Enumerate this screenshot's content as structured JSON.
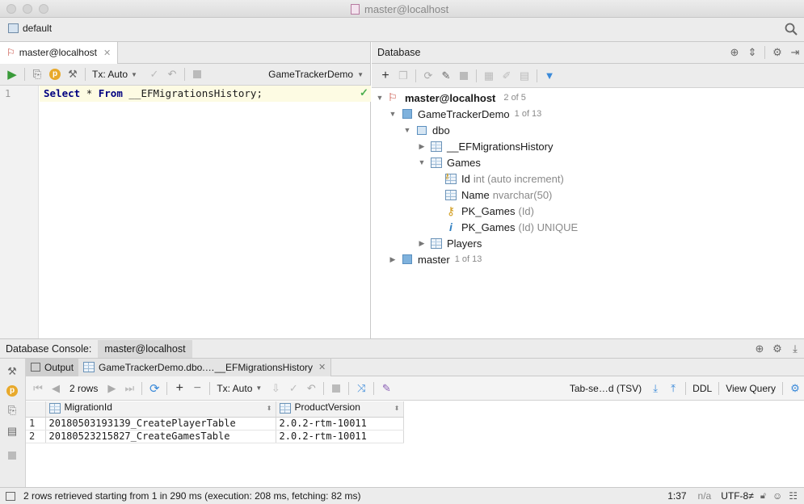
{
  "window": {
    "title": "master@localhost"
  },
  "navbar": {
    "breadcrumb": "default"
  },
  "editor": {
    "tab_label": "master@localhost",
    "tx_mode": "Tx: Auto",
    "schema": "GameTrackerDemo",
    "line_number": "1",
    "code": {
      "kw1": "Select",
      "star": "*",
      "kw2": "From",
      "ident": "__EFMigrationsHistory",
      "semi": ";"
    }
  },
  "database": {
    "title": "Database",
    "tree": [
      {
        "label": "master@localhost",
        "meta": "2 of 5"
      },
      {
        "label": "GameTrackerDemo",
        "meta": "1 of 13"
      },
      {
        "label": "dbo",
        "meta": ""
      },
      {
        "label": "__EFMigrationsHistory",
        "meta": ""
      },
      {
        "label": "Games",
        "meta": ""
      },
      {
        "label": "Id",
        "meta": "int (auto increment)"
      },
      {
        "label": "Name",
        "meta": "nvarchar(50)"
      },
      {
        "label": "PK_Games",
        "meta": "(Id)"
      },
      {
        "label": "PK_Games",
        "meta": "(Id) UNIQUE"
      },
      {
        "label": "Players",
        "meta": ""
      },
      {
        "label": "master",
        "meta": "1 of 13"
      }
    ]
  },
  "console": {
    "title": "Database Console:",
    "tab": "master@localhost",
    "output_tab": "Output",
    "result_tab": "GameTrackerDemo.dbo.…__EFMigrationsHistory",
    "rows_label": "2 rows",
    "tx_mode": "Tx: Auto",
    "format": "Tab-se…d (TSV)",
    "ddl": "DDL",
    "view_query": "View Query",
    "columns": [
      "MigrationId",
      "ProductVersion"
    ],
    "rows": [
      {
        "n": "1",
        "cells": [
          "20180503193139_CreatePlayerTable",
          "2.0.2-rtm-10011"
        ]
      },
      {
        "n": "2",
        "cells": [
          "20180523215827_CreateGamesTable",
          "2.0.2-rtm-10011"
        ]
      }
    ]
  },
  "status": {
    "message": "2 rows retrieved starting from 1 in 290 ms (execution: 208 ms, fetching: 82 ms)",
    "position": "1:37",
    "na": "n/a",
    "encoding": "UTF-8≠"
  }
}
